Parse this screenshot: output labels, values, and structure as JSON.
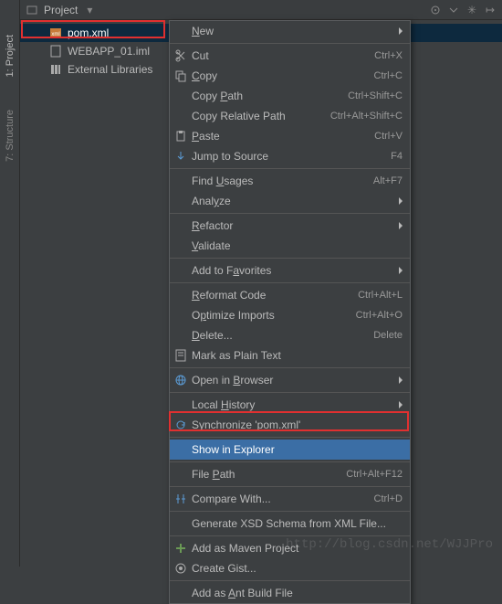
{
  "leftTabs": [
    {
      "id": "project",
      "label": "1: Project",
      "active": true
    },
    {
      "id": "structure",
      "label": "7: Structure",
      "active": false
    }
  ],
  "panelHeader": {
    "title": "Project"
  },
  "tree": {
    "items": [
      {
        "id": "pom",
        "label": "pom.xml",
        "selected": true,
        "icon": "xml"
      },
      {
        "id": "iml",
        "label": "WEBAPP_01.iml",
        "selected": false,
        "icon": "file"
      },
      {
        "id": "ext",
        "label": "External Libraries",
        "selected": false,
        "icon": "lib"
      }
    ]
  },
  "menu": [
    {
      "type": "item",
      "label": "New",
      "submenu": true,
      "u": 0
    },
    {
      "type": "sep"
    },
    {
      "type": "item",
      "label": "Cut",
      "shortcut": "Ctrl+X",
      "icon": "cut"
    },
    {
      "type": "item",
      "label": "Copy",
      "shortcut": "Ctrl+C",
      "icon": "copy",
      "u": 0
    },
    {
      "type": "item",
      "label": "Copy Path",
      "shortcut": "Ctrl+Shift+C",
      "u": 5
    },
    {
      "type": "item",
      "label": "Copy Relative Path",
      "shortcut": "Ctrl+Alt+Shift+C"
    },
    {
      "type": "item",
      "label": "Paste",
      "shortcut": "Ctrl+V",
      "icon": "paste",
      "u": 0
    },
    {
      "type": "item",
      "label": "Jump to Source",
      "shortcut": "F4",
      "icon": "jump"
    },
    {
      "type": "sep"
    },
    {
      "type": "item",
      "label": "Find Usages",
      "shortcut": "Alt+F7",
      "u": 5
    },
    {
      "type": "item",
      "label": "Analyze",
      "submenu": true,
      "u": 4
    },
    {
      "type": "sep"
    },
    {
      "type": "item",
      "label": "Refactor",
      "submenu": true,
      "u": 0
    },
    {
      "type": "item",
      "label": "Validate",
      "u": 0
    },
    {
      "type": "sep"
    },
    {
      "type": "item",
      "label": "Add to Favorites",
      "submenu": true,
      "u": 8
    },
    {
      "type": "sep"
    },
    {
      "type": "item",
      "label": "Reformat Code",
      "shortcut": "Ctrl+Alt+L",
      "u": 0
    },
    {
      "type": "item",
      "label": "Optimize Imports",
      "shortcut": "Ctrl+Alt+O",
      "u": 1
    },
    {
      "type": "item",
      "label": "Delete...",
      "shortcut": "Delete",
      "u": 0
    },
    {
      "type": "item",
      "label": "Mark as Plain Text",
      "icon": "text"
    },
    {
      "type": "sep"
    },
    {
      "type": "item",
      "label": "Open in Browser",
      "submenu": true,
      "icon": "globe",
      "u": 8
    },
    {
      "type": "sep"
    },
    {
      "type": "item",
      "label": "Local History",
      "submenu": true,
      "u": 6
    },
    {
      "type": "item",
      "label": "Synchronize 'pom.xml'",
      "icon": "sync"
    },
    {
      "type": "sep"
    },
    {
      "type": "item",
      "label": "Show in Explorer",
      "selected": true
    },
    {
      "type": "sep"
    },
    {
      "type": "item",
      "label": "File Path",
      "shortcut": "Ctrl+Alt+F12",
      "u": 5
    },
    {
      "type": "sep"
    },
    {
      "type": "item",
      "label": "Compare With...",
      "shortcut": "Ctrl+D",
      "icon": "compare"
    },
    {
      "type": "sep"
    },
    {
      "type": "item",
      "label": "Generate XSD Schema from XML File..."
    },
    {
      "type": "sep"
    },
    {
      "type": "item",
      "label": "Add as Maven Project",
      "icon": "plus"
    },
    {
      "type": "item",
      "label": "Create Gist...",
      "icon": "gist"
    },
    {
      "type": "sep"
    },
    {
      "type": "item",
      "label": "Add as Ant Build File",
      "u": 7
    }
  ],
  "watermark": "http://blog.csdn.net/WJJPro"
}
